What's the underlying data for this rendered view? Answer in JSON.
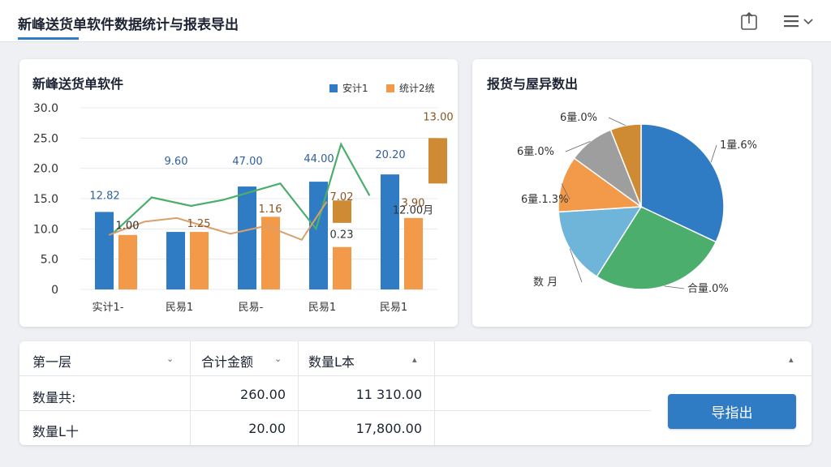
{
  "header": {
    "title": "新峰送货单软件数据统计与报表导出",
    "export_icon": "export-icon",
    "menu_icon": "menu-icon"
  },
  "bar_card": {
    "title": "新峰送货单软件",
    "legend": [
      {
        "label": "安计1",
        "color": "#2f7bc4"
      },
      {
        "label": "统计2统",
        "color": "#f39a4a"
      }
    ]
  },
  "pie_card": {
    "title": "报货与屋异数出"
  },
  "colors": {
    "accent": "#2f7bc4",
    "orange": "#f39a4a",
    "dark_orange": "#cf8a34",
    "green": "#4cae6c",
    "gray": "#9e9e9e",
    "light_blue": "#6fb5d9"
  },
  "chart_data": [
    {
      "type": "bar",
      "title": "新峰送货单软件",
      "categories": [
        "实计1-",
        "民易1",
        "民易-",
        "民易1",
        "民易1"
      ],
      "yticks": [
        "30.0",
        "25.0",
        "20.0",
        "15.0",
        "10.0",
        "5.0",
        "0"
      ],
      "ylim": [
        0,
        30
      ],
      "series": [
        {
          "name": "安计1",
          "values": [
            12.8,
            9.5,
            17.0,
            17.8,
            19.0
          ]
        },
        {
          "name": "统计2统",
          "values": [
            9.0,
            9.5,
            12.0,
            7.0,
            11.8
          ]
        }
      ],
      "extra_bars": [
        {
          "category": "民易1",
          "from": 17.5,
          "to": 25.0,
          "label": "13.00"
        },
        {
          "category": "民易1",
          "from": 11.0,
          "to": 14.7,
          "label": "7.02"
        }
      ],
      "lines": [
        {
          "name": "green",
          "values": [
            9.0,
            15.2,
            13.8,
            17.5,
            10.0,
            24.0,
            15.0
          ],
          "x_positions": [
            0.3,
            1.0,
            1.6,
            2.0,
            3.0,
            3.2,
            3.8,
            4.1,
            4.3
          ]
        },
        {
          "name": "orange",
          "values": [
            9.0,
            11.0,
            9.2,
            10.0,
            8.2,
            14.5
          ]
        }
      ],
      "data_labels": [
        {
          "text": "12.82",
          "category": 0,
          "value": 14.9
        },
        {
          "text": "9.60",
          "category": 1,
          "value": 20.6
        },
        {
          "text": "47.00",
          "category": 2,
          "value": 20.6
        },
        {
          "text": "44.00",
          "category": 3,
          "value": 21.0
        },
        {
          "text": "20.20",
          "category": 4,
          "value": 21.7
        },
        {
          "text": "1.00",
          "category": 0,
          "value": 10.0
        },
        {
          "text": "1.25",
          "category": 1,
          "value": 10.3
        },
        {
          "text": "1.16",
          "category": 2,
          "value": 12.7
        },
        {
          "text": "7.02",
          "category": 3,
          "value": 14.7
        },
        {
          "text": "0.23",
          "category": 3,
          "value": 8.5
        },
        {
          "text": "3.90",
          "category": 4,
          "value": 13.7
        },
        {
          "text": "13.00",
          "category": 4,
          "value": 27.9
        },
        {
          "text": "12.00月",
          "category": 4,
          "value": 12.5
        }
      ],
      "grid": true,
      "legend_position": "top-right"
    },
    {
      "type": "pie",
      "title": "报货与屋异数出",
      "slices": [
        {
          "label": "1量.6%",
          "value": 32,
          "color": "#2f7bc4"
        },
        {
          "label": "合量.0%",
          "value": 27,
          "color": "#4cae6c"
        },
        {
          "label": "数 月",
          "value": 15,
          "color": "#6fb5d9"
        },
        {
          "label": "6量.1.3%",
          "value": 11,
          "color": "#f39a4a"
        },
        {
          "label": "6量.0%",
          "value": 9,
          "color": "#9e9e9e"
        },
        {
          "label": "6量.0%",
          "value": 6,
          "color": "#cf8a34"
        }
      ]
    }
  ],
  "table": {
    "headers": [
      "第一层",
      "合计金额",
      "数量L本"
    ],
    "rows": [
      [
        "数量共:",
        "260.00",
        "11 310.00"
      ],
      [
        "数量L十",
        "20.00",
        "17,800.00"
      ]
    ]
  },
  "actions": {
    "export_label": "导指出"
  }
}
